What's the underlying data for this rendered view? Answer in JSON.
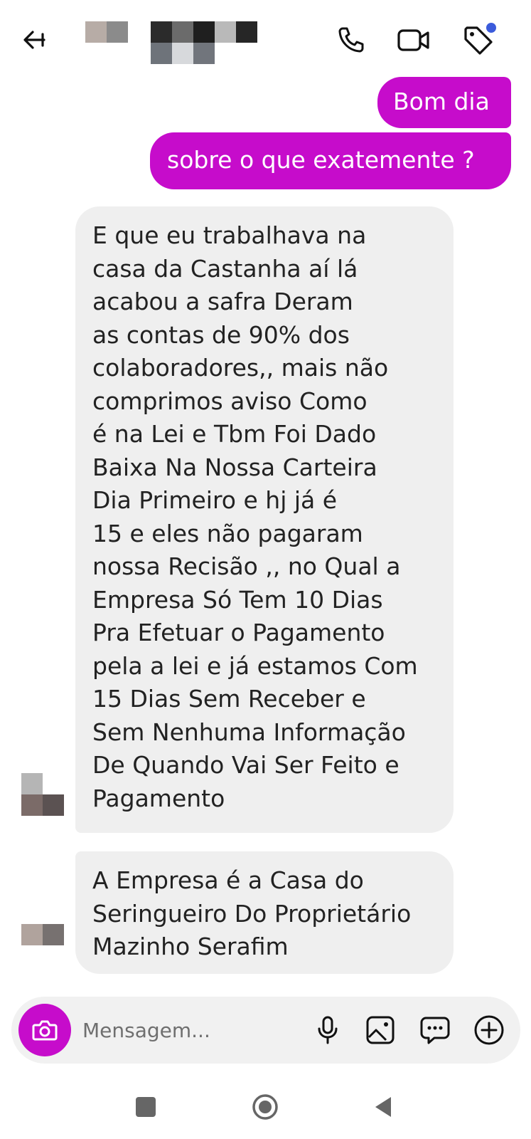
{
  "header": {
    "back_icon": "arrow-left-icon",
    "call_icon": "phone-icon",
    "video_icon": "video-camera-icon",
    "tag_icon": "tag-icon",
    "notification_dot_color": "#3b5bdb"
  },
  "messages": [
    {
      "direction": "outgoing",
      "text": "Bom dia"
    },
    {
      "direction": "outgoing",
      "text": "sobre o que  exatemente ?"
    },
    {
      "direction": "incoming",
      "text": "E que eu trabalhava na\ncasa da Castanha aí lá\nacabou a safra Deram\nas contas de 90% dos\ncolaboradores,, mais não\ncomprimos aviso Como\né na Lei e Tbm Foi Dado\nBaixa Na Nossa Carteira\nDia Primeiro e hj já é\n15 e eles não pagaram\nnossa Recisão ,, no Qual a\nEmpresa Só Tem 10 Dias\nPra Efetuar o Pagamento\npela a lei e já estamos Com\n15 Dias Sem Receber e\nSem Nenhuma Informação\nDe Quando Vai Ser Feito e\nPagamento"
    },
    {
      "direction": "incoming",
      "text": "A Empresa é a Casa do\nSeringueiro Do Proprietário\nMazinho Serafim"
    }
  ],
  "composer": {
    "placeholder": "Mensagem...",
    "camera_icon": "camera-icon",
    "mic_icon": "microphone-icon",
    "gallery_icon": "image-icon",
    "sticker_icon": "chat-bubble-icon",
    "add_icon": "plus-circle-icon"
  },
  "navbar": {
    "recents_icon": "square-icon",
    "home_icon": "circle-icon",
    "back_icon": "triangle-back-icon"
  },
  "colors": {
    "outgoing_bubble": "#c60ccb",
    "incoming_bubble": "#efefef",
    "accent": "#c60ccb"
  }
}
